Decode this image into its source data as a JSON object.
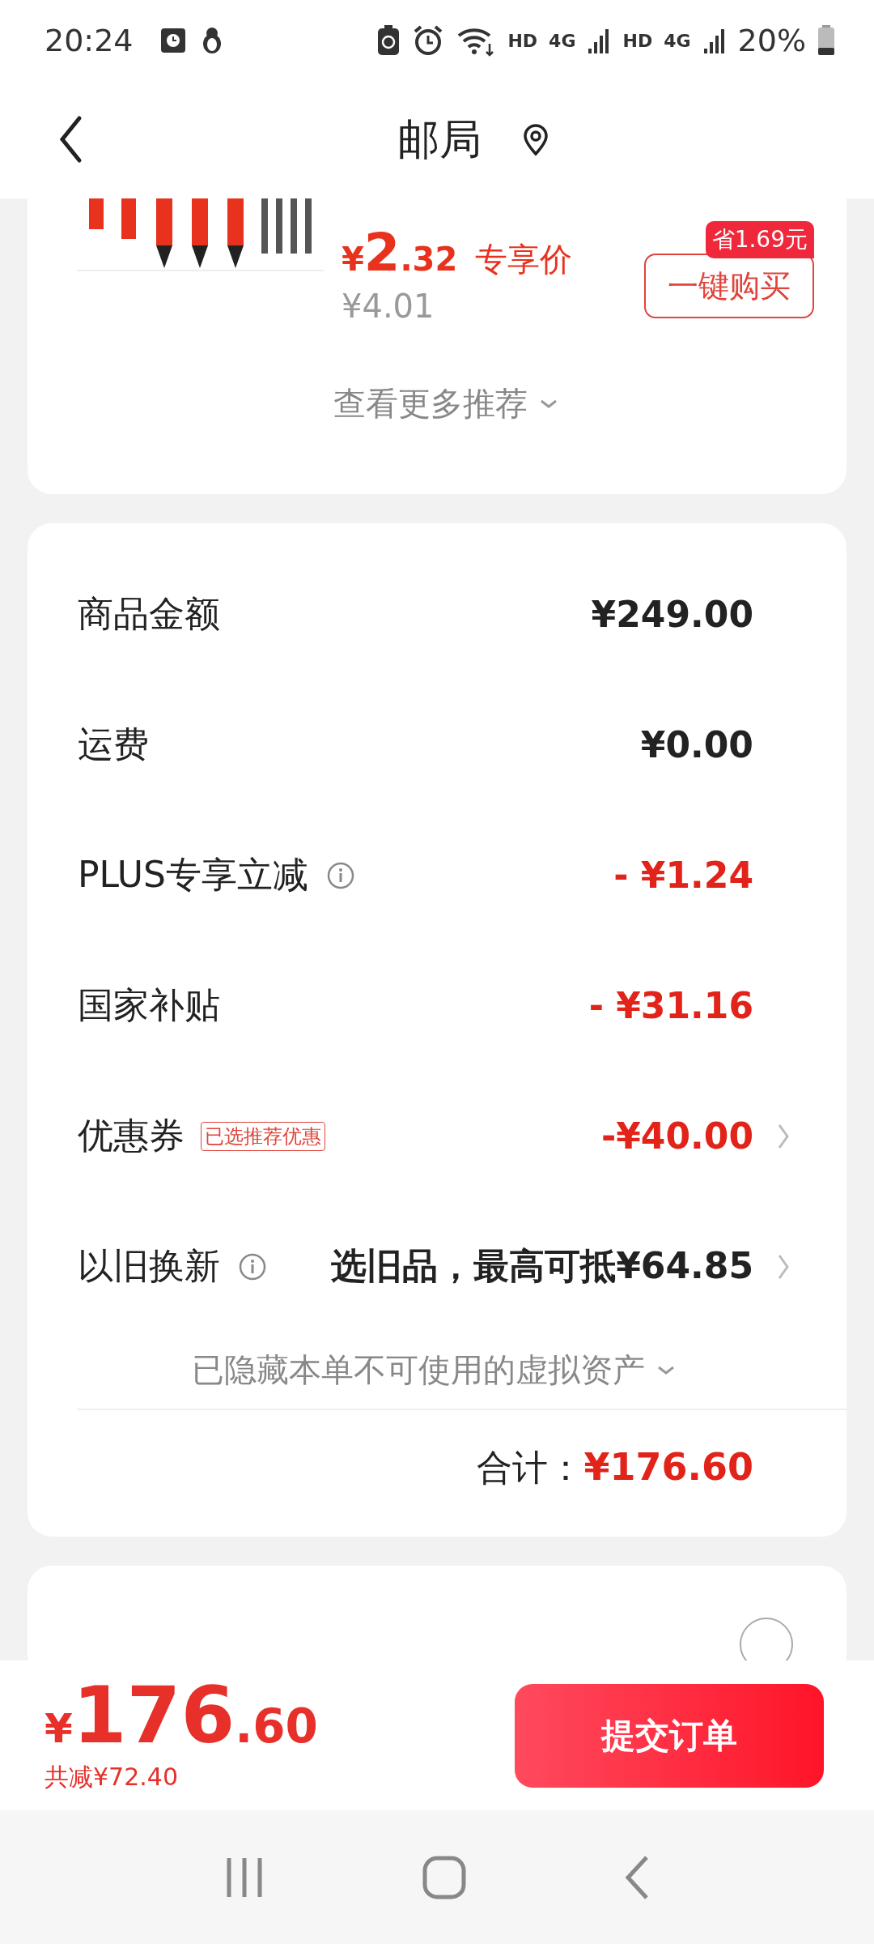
{
  "status_bar": {
    "time": "20:24",
    "indicators": [
      "HD",
      "4G",
      "HD",
      "4G"
    ],
    "battery": "20%"
  },
  "header": {
    "title": "邮局"
  },
  "recommendation": {
    "price_symbol": "¥",
    "price_integer": "2",
    "price_decimal": ".32",
    "price_label": "专享价",
    "original_price": "¥4.01",
    "savings_badge": "省1.69元",
    "buy_button": "一键购买",
    "more_link": "查看更多推荐"
  },
  "summary": {
    "rows": [
      {
        "label": "商品金额",
        "value": "¥249.00",
        "kind": "plain",
        "info": false,
        "chevron": false
      },
      {
        "label": "运费",
        "value": "¥0.00",
        "kind": "plain",
        "info": false,
        "chevron": false
      },
      {
        "label": "PLUS专享立减",
        "value": "- ¥1.24",
        "kind": "discount",
        "info": true,
        "chevron": false
      },
      {
        "label": "国家补贴",
        "value": "- ¥31.16",
        "kind": "discount",
        "info": false,
        "chevron": false
      },
      {
        "label": "优惠券",
        "tag": "已选推荐优惠",
        "value": "-¥40.00",
        "kind": "discount",
        "info": false,
        "chevron": true
      },
      {
        "label": "以旧换新",
        "value": "选旧品，最高可抵¥64.85",
        "kind": "plain",
        "info": true,
        "chevron": true
      }
    ],
    "hidden_note": "已隐藏本单不可使用的虚拟资产",
    "total_label": "合计：",
    "total_value": "¥176.60"
  },
  "payment_option": {
    "selected": false
  },
  "checkout": {
    "price_symbol": "¥",
    "price_integer": "176",
    "price_decimal": ".60",
    "savings": "共减¥72.40",
    "submit_button": "提交订单"
  }
}
